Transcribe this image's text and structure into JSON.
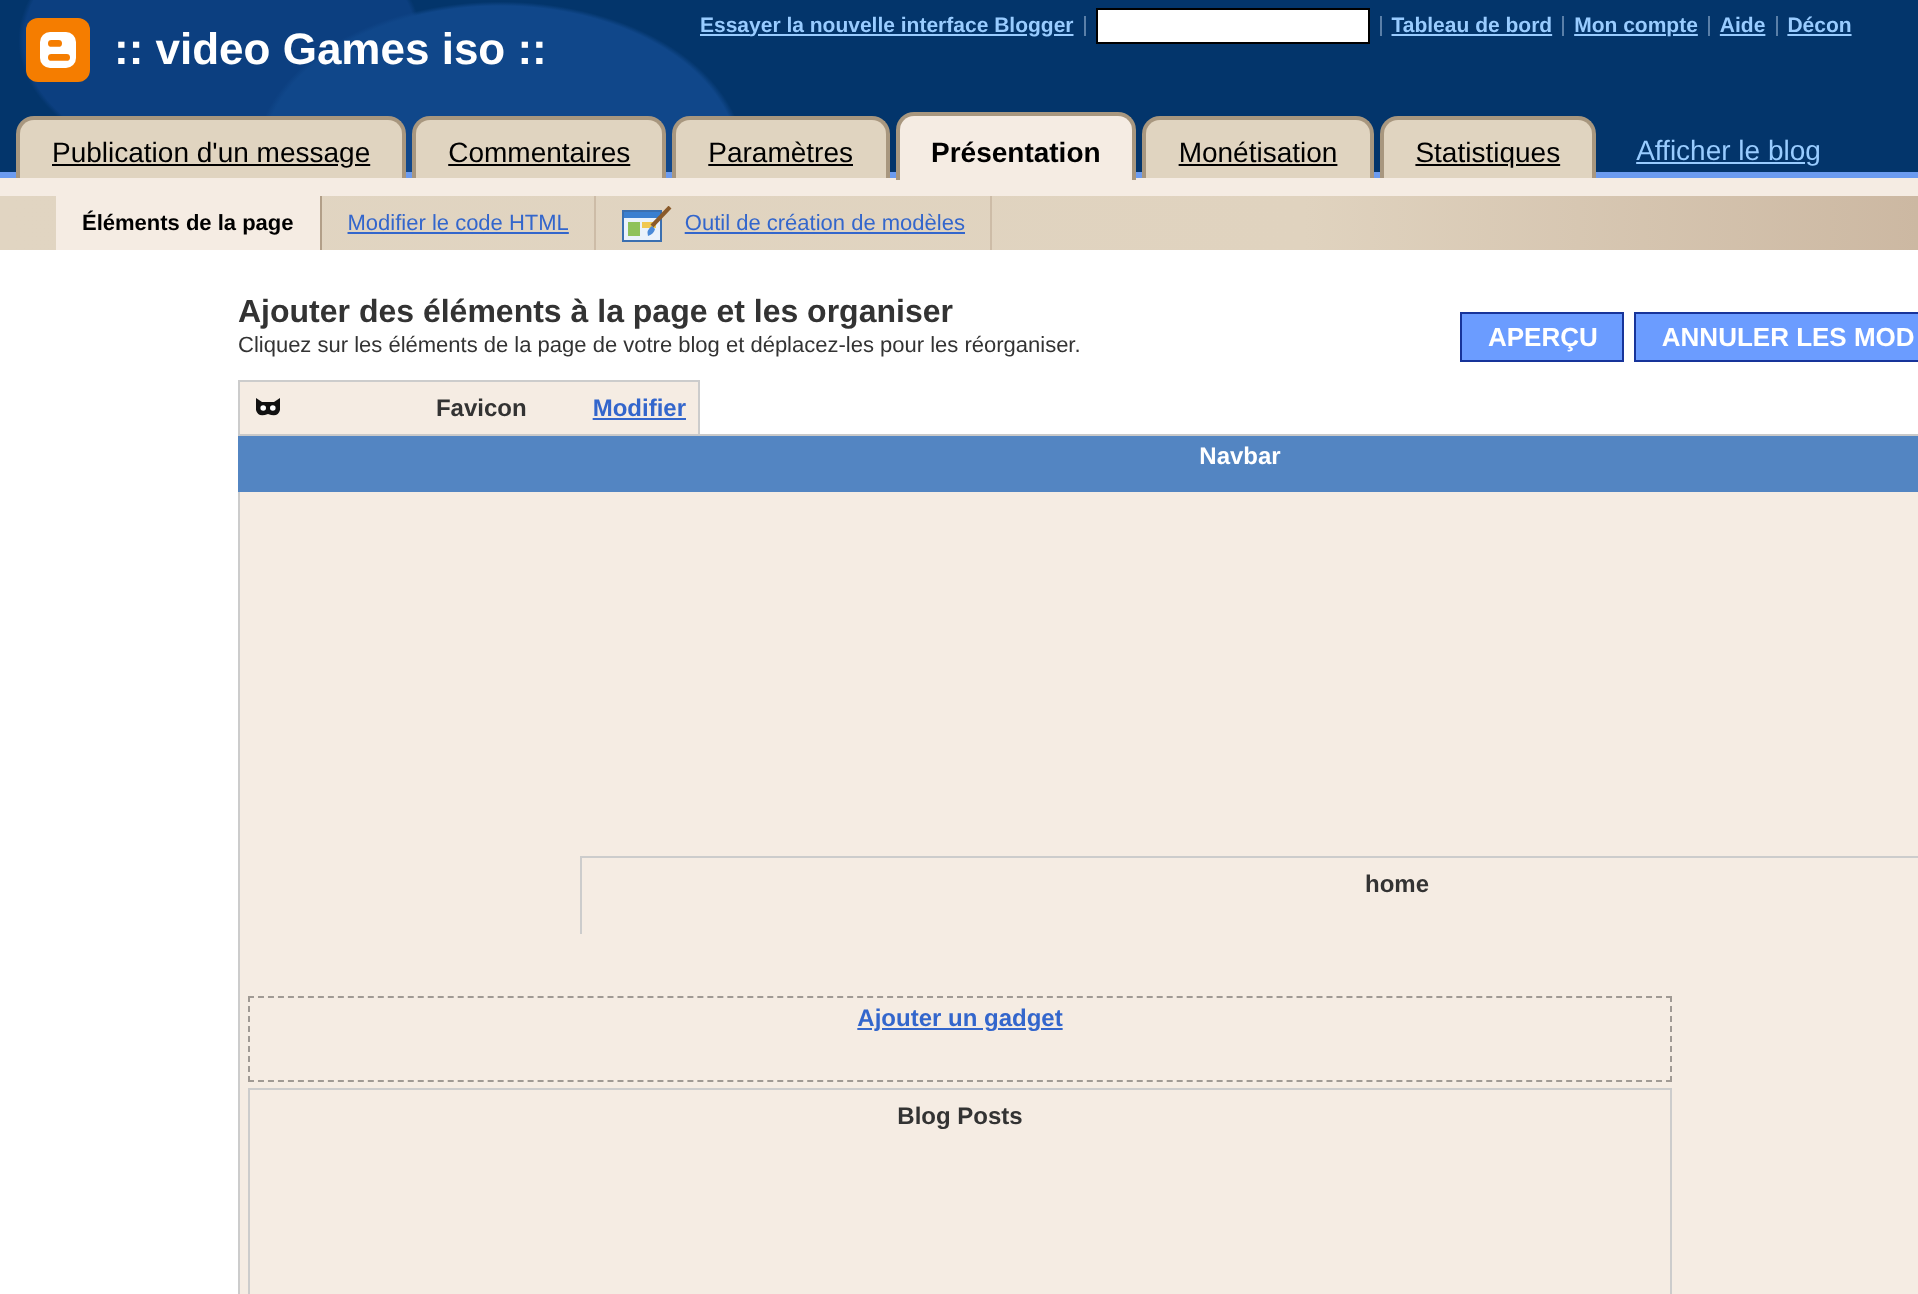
{
  "header": {
    "title": ":: video Games iso ::",
    "promo_link": "Essayer la nouvelle interface Blogger",
    "account_links": [
      "Tableau de bord",
      "Mon compte",
      "Aide",
      "Décon"
    ]
  },
  "tabs": [
    {
      "label": "Publication d'un message",
      "selected": false
    },
    {
      "label": "Commentaires",
      "selected": false
    },
    {
      "label": "Paramètres",
      "selected": false
    },
    {
      "label": "Présentation",
      "selected": true
    },
    {
      "label": "Monétisation",
      "selected": false
    },
    {
      "label": "Statistiques",
      "selected": false
    }
  ],
  "view_blog_link": "Afficher le blog",
  "subtabs": [
    {
      "label": "Éléments de la page",
      "selected": true,
      "kind": "text"
    },
    {
      "label": "Modifier le code HTML",
      "selected": false,
      "kind": "text"
    },
    {
      "label": "Outil de création de modèles",
      "selected": false,
      "kind": "icon_link"
    }
  ],
  "page": {
    "title": "Ajouter des éléments à la page et les organiser",
    "subtitle": "Cliquez sur les éléments de la page de votre blog et déplacez-les pour les réorganiser.",
    "buttons": [
      "APERÇU",
      "ANNULER LES MOD"
    ]
  },
  "layout": {
    "favicon": {
      "title": "Favicon",
      "edit_link": "Modifier"
    },
    "navbar": {
      "title": "Navbar"
    },
    "header": {
      "title": "home"
    },
    "add_gadget_link": "Ajouter un gadget",
    "blog_posts": {
      "title": "Blog Posts"
    }
  }
}
